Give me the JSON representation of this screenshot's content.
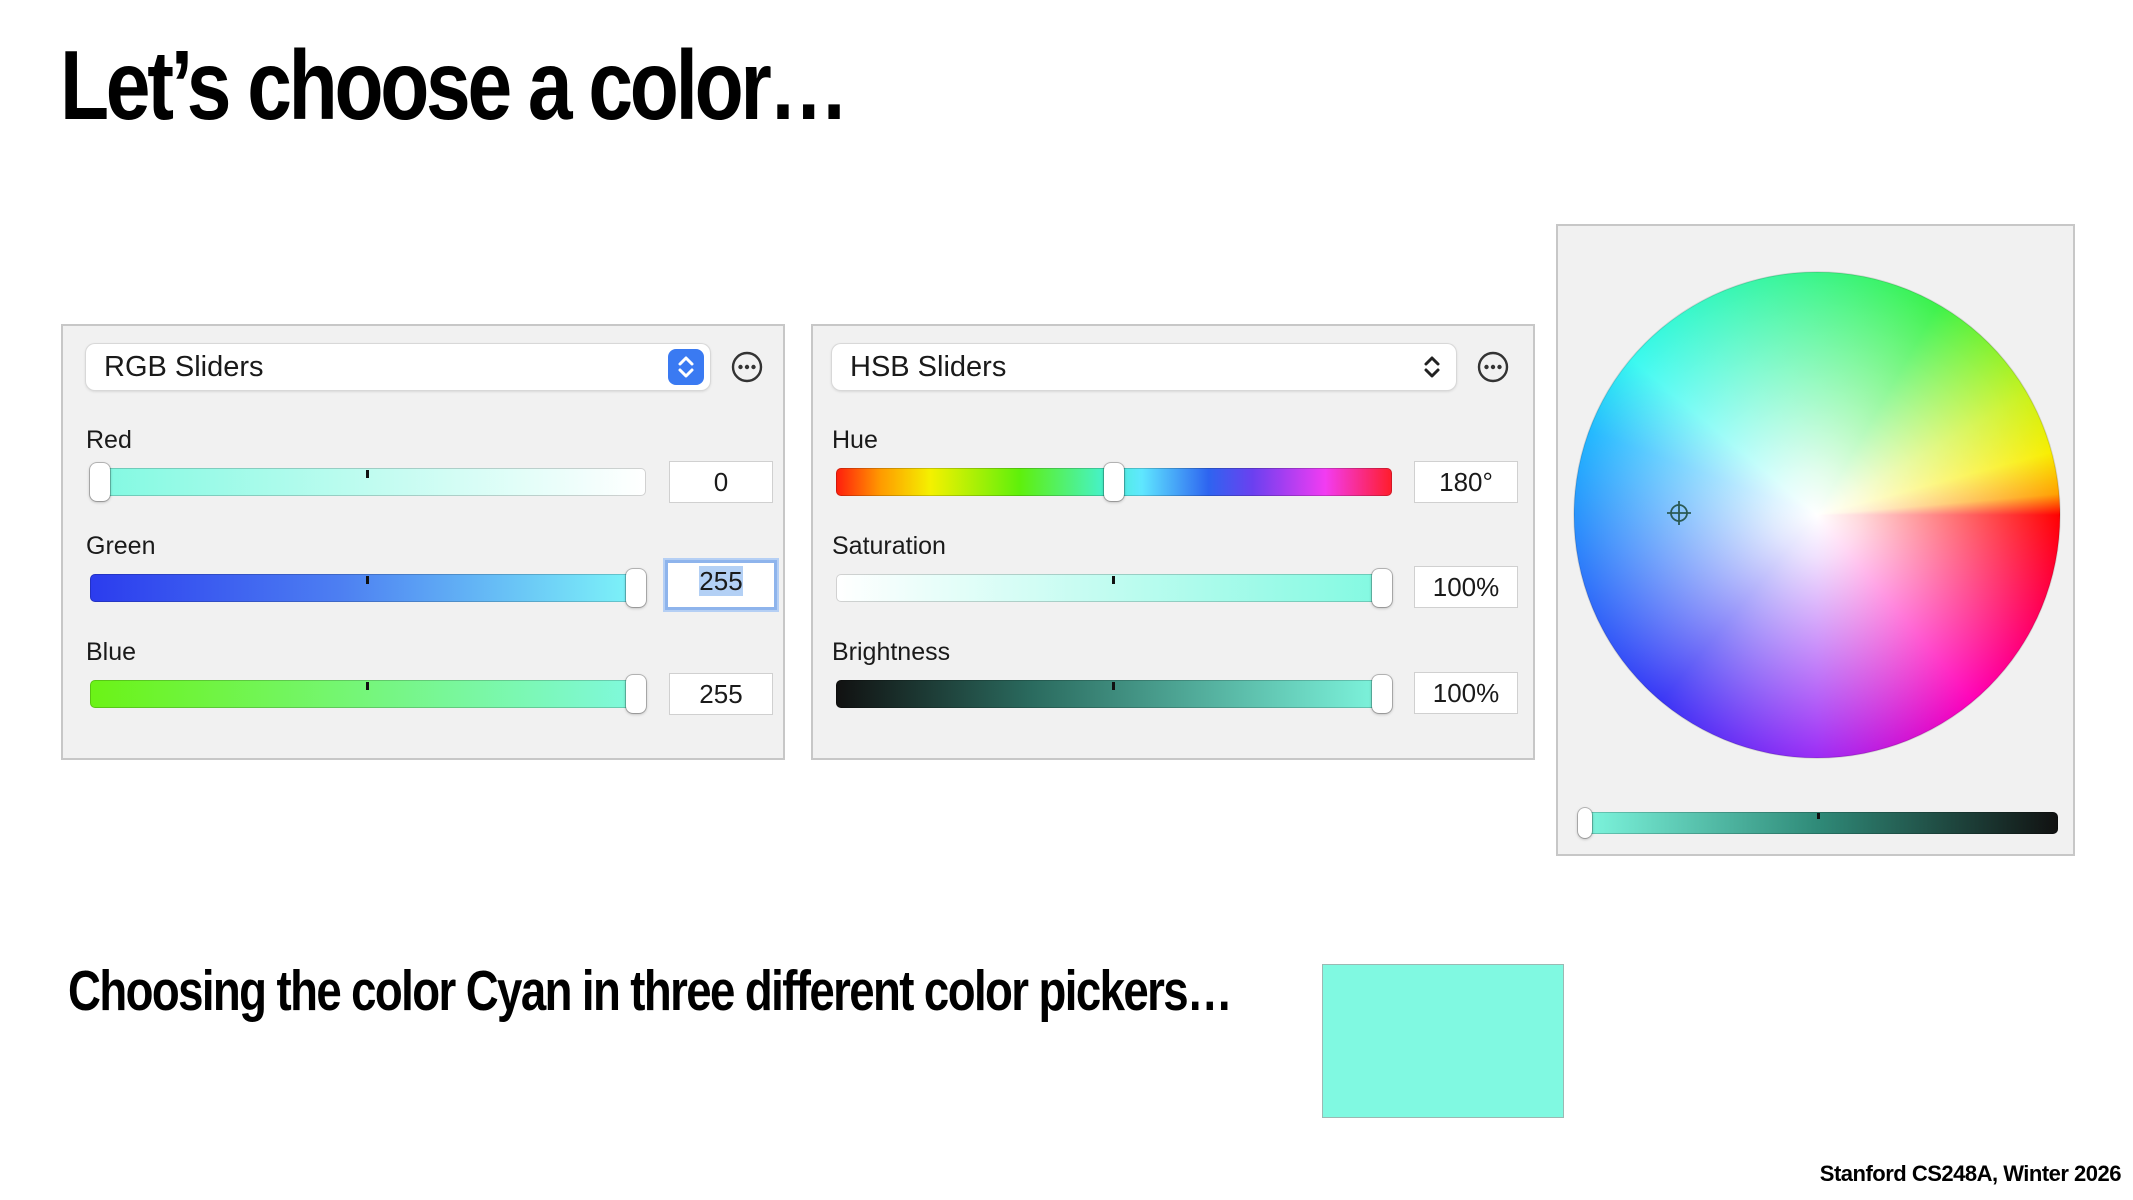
{
  "slide": {
    "title": "Let’s choose a color…",
    "caption": "Choosing the color Cyan in three different color pickers…",
    "footer": "Stanford CS248A, Winter 2026",
    "swatch_color": "#80f9e1"
  },
  "rgb_panel": {
    "mode": "RGB Sliders",
    "sliders": [
      {
        "label": "Red",
        "value": "0",
        "fraction": 0.0
      },
      {
        "label": "Green",
        "value": "255",
        "fraction": 1.0,
        "focused": true
      },
      {
        "label": "Blue",
        "value": "255",
        "fraction": 1.0
      }
    ]
  },
  "hsb_panel": {
    "mode": "HSB Sliders",
    "sliders": [
      {
        "label": "Hue",
        "value": "180°",
        "fraction": 0.5
      },
      {
        "label": "Saturation",
        "value": "100%",
        "fraction": 1.0
      },
      {
        "label": "Brightness",
        "value": "100%",
        "fraction": 1.0
      }
    ]
  },
  "wheel_panel": {
    "brightness_fraction": 1.0,
    "selected_hue_deg": 180
  },
  "icons": [
    "chevron-updown-icon",
    "more-options-icon",
    "crosshair-icon"
  ]
}
